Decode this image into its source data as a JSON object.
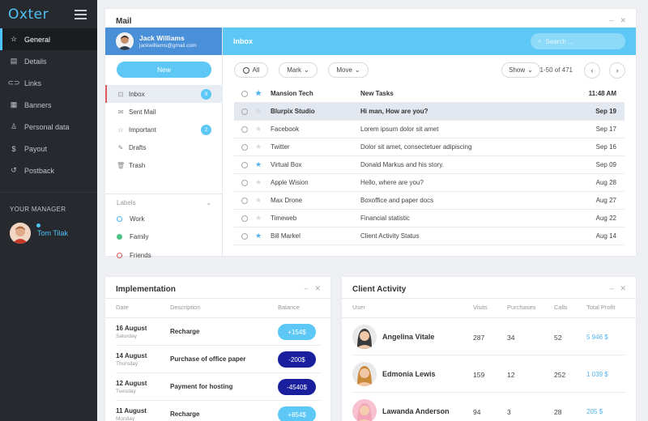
{
  "sidebar": {
    "logo": "Oxter",
    "items": [
      {
        "label": "General",
        "icon": "star-icon",
        "active": true
      },
      {
        "label": "Details",
        "icon": "list-icon"
      },
      {
        "label": "Links",
        "icon": "link-icon"
      },
      {
        "label": "Banners",
        "icon": "grid-icon"
      },
      {
        "label": "Personal data",
        "icon": "user-icon"
      },
      {
        "label": "Payout",
        "icon": "dollar-icon"
      },
      {
        "label": "Postback",
        "icon": "refresh-icon"
      }
    ],
    "manager_title": "YOUR MANAGER",
    "manager_name": "Tom Tilak"
  },
  "mail": {
    "title": "Mail",
    "user_name": "Jack Williams",
    "user_email": "jackwilliams@gmail.com",
    "new_label": "New",
    "folders": [
      {
        "label": "Inbox",
        "badge": "9"
      },
      {
        "label": "Sent Mail"
      },
      {
        "label": "Important",
        "badge": "2"
      },
      {
        "label": "Drafts"
      },
      {
        "label": "Trash"
      }
    ],
    "labels_title": "Labels",
    "labels": [
      {
        "label": "Work",
        "color": "#4fb3f0"
      },
      {
        "label": "Family",
        "color": "#4cc28a"
      },
      {
        "label": "Friends",
        "color": "#e25a5a"
      }
    ],
    "inbox_title": "Inbox",
    "search_placeholder": "Search ...",
    "toolbar": {
      "all": "All",
      "mark": "Mark",
      "move": "Move",
      "show": "Show",
      "pager": "1-50 of 471"
    },
    "messages": [
      {
        "from": "Mansion Tech",
        "subject": "New Tasks",
        "date": "11:48 AM",
        "starred": true,
        "unread": true
      },
      {
        "from": "Blurpix Studio",
        "subject": "Hi man, How are you?",
        "date": "Sep 19",
        "starred": false,
        "unread": true,
        "selected": true
      },
      {
        "from": "Facebook",
        "subject": "Lorem ipsum dolor sit amet",
        "date": "Sep 17",
        "starred": false
      },
      {
        "from": "Twitter",
        "subject": "Dolor sit amet, consectetuer adipiscing",
        "date": "Sep 16",
        "starred": false
      },
      {
        "from": "Virtual Box",
        "subject": "Donald Markus and his story.",
        "date": "Sep 09",
        "starred": true
      },
      {
        "from": "Apple Wision",
        "subject": "Hello, where are you?",
        "date": "Aug 28",
        "starred": false
      },
      {
        "from": "Max Drone",
        "subject": "Boxoffice and paper docs",
        "date": "Aug 27",
        "starred": false
      },
      {
        "from": "Timeweb",
        "subject": "Financial statistic",
        "date": "Aug 22",
        "starred": false
      },
      {
        "from": "Bill Markel",
        "subject": "Client Activity Status",
        "date": "Aug 14",
        "starred": true
      }
    ]
  },
  "implementation": {
    "title": "Implementation",
    "headers": {
      "date": "Date",
      "description": "Description",
      "balance": "Balance"
    },
    "rows": [
      {
        "date": "16 August",
        "day": "Saturday",
        "desc": "Recharge",
        "balance": "+154$",
        "color": "#5dc8f5"
      },
      {
        "date": "14 August",
        "day": "Thursday",
        "desc": "Purchase of office paper",
        "balance": "-200$",
        "color": "#1a1f9e"
      },
      {
        "date": "12 August",
        "day": "Tuesday",
        "desc": "Payment for hosting",
        "balance": "-4540$",
        "color": "#1a1f9e"
      },
      {
        "date": "11 August",
        "day": "Monday",
        "desc": "Recharge",
        "balance": "+854$",
        "color": "#5dc8f5"
      }
    ]
  },
  "client_activity": {
    "title": "Client Activity",
    "headers": {
      "user": "User",
      "visits": "Visits",
      "purchases": "Purchases",
      "calls": "Calls",
      "profit": "Total Profit"
    },
    "rows": [
      {
        "name": "Angelina Vitale",
        "visits": "287",
        "purchases": "34",
        "calls": "52",
        "profit": "5 946 $"
      },
      {
        "name": "Edmonia Lewis",
        "visits": "159",
        "purchases": "12",
        "calls": "252",
        "profit": "1 039 $"
      },
      {
        "name": "Lawanda Anderson",
        "visits": "94",
        "purchases": "3",
        "calls": "28",
        "profit": "205 $"
      }
    ]
  }
}
